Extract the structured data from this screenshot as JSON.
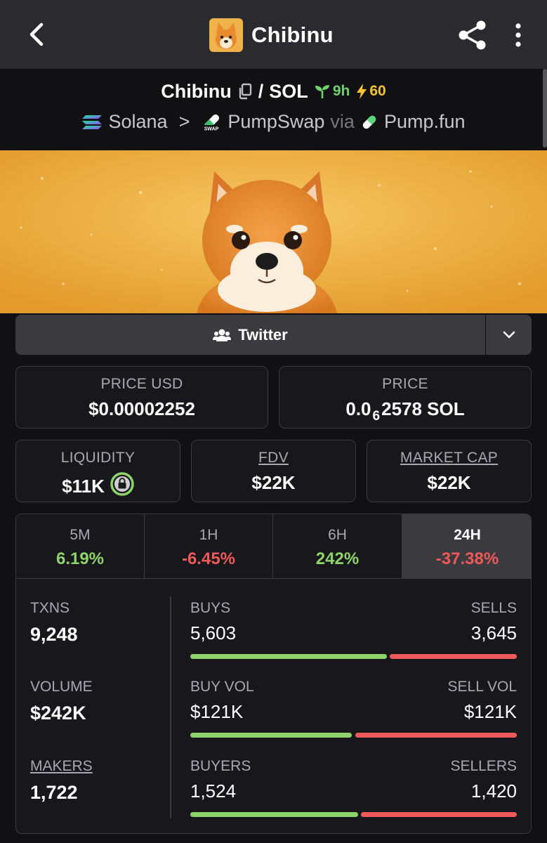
{
  "header": {
    "title": "Chibinu"
  },
  "pair": {
    "base": "Chibinu",
    "separator": "/",
    "quote": "SOL",
    "age": "9h",
    "boost": "60",
    "chain": "Solana",
    "chevron": ">",
    "dex": "PumpSwap",
    "via": "via",
    "launchpad": "Pump.fun"
  },
  "social": {
    "twitter_label": "Twitter"
  },
  "price": {
    "usd_label": "PRICE USD",
    "usd_value": "$0.00002252",
    "native_label": "PRICE",
    "native_prefix": "0.0",
    "native_subscript": "6",
    "native_rest": "2578 SOL"
  },
  "metrics": {
    "liquidity_label": "LIQUIDITY",
    "liquidity_value": "$11K",
    "fdv_label": "FDV",
    "fdv_value": "$22K",
    "mcap_label": "MARKET CAP",
    "mcap_value": "$22K"
  },
  "timeframes": [
    {
      "label": "5M",
      "change": "6.19%"
    },
    {
      "label": "1H",
      "change": "-6.45%"
    },
    {
      "label": "6H",
      "change": "242%"
    },
    {
      "label": "24H",
      "change": "-37.38%"
    }
  ],
  "stats": {
    "txns_label": "TXNS",
    "txns_value": "9,248",
    "volume_label": "VOLUME",
    "volume_value": "$242K",
    "makers_label": "MAKERS",
    "makers_value": "1,722",
    "buys_label": "BUYS",
    "buys_value": "5,603",
    "sells_label": "SELLS",
    "sells_value": "3,645",
    "buys_ratio": 0.606,
    "buy_vol_label": "BUY VOL",
    "buy_vol_value": "$121K",
    "sell_vol_label": "SELL VOL",
    "sell_vol_value": "$121K",
    "buy_vol_ratio": 0.5,
    "buyers_label": "BUYERS",
    "buyers_value": "1,524",
    "sellers_label": "SELLERS",
    "sellers_value": "1,420",
    "buyers_ratio": 0.518
  },
  "colors": {
    "positive": "#8ed36a",
    "negative": "#ee5a5a",
    "age": "#6fd16b",
    "boost": "#f7c233"
  }
}
